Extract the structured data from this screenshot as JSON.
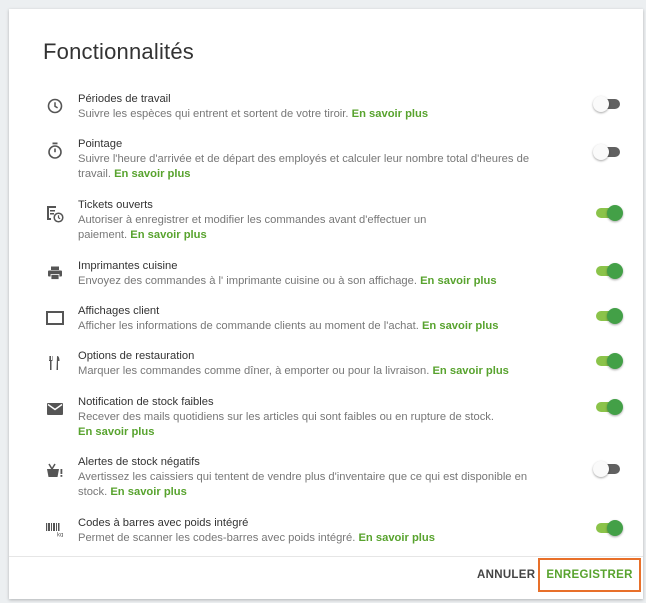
{
  "title": "Fonctionnalités",
  "link_label": "En savoir plus",
  "features": [
    {
      "name": "Périodes de travail",
      "desc": "Suivre les espèces qui entrent et sortent de votre tiroir.",
      "icon": "clock-icon",
      "enabled": false
    },
    {
      "name": "Pointage",
      "desc": "Suivre l'heure d'arrivée et de départ des employés et calculer leur nombre total d'heures de travail.",
      "icon": "stopwatch-icon",
      "enabled": false
    },
    {
      "name": "Tickets ouverts",
      "desc": "Autoriser à enregistrer et modifier les commandes avant d'effectuer un paiement.",
      "icon": "ticket-clock-icon",
      "enabled": true
    },
    {
      "name": "Imprimantes cuisine",
      "desc": "Envoyez des commandes à l' imprimante cuisine ou à son affichage.",
      "icon": "printer-icon",
      "enabled": true
    },
    {
      "name": "Affichages client",
      "desc": "Afficher les informations de commande clients au moment de l'achat.",
      "icon": "display-icon",
      "enabled": true
    },
    {
      "name": "Options de restauration",
      "desc": "Marquer les commandes comme dîner, à emporter ou pour la livraison.",
      "icon": "fork-knife-icon",
      "enabled": true
    },
    {
      "name": "Notification de stock faibles",
      "desc": "Recever des mails quotidiens sur les articles qui sont faibles ou en rupture de stock.",
      "icon": "mail-icon",
      "enabled": true
    },
    {
      "name": "Alertes de stock négatifs",
      "desc": "Avertissez les caissiers qui tentent de vendre plus d'inventaire que ce qui est disponible en stock.",
      "icon": "basket-alert-icon",
      "enabled": false
    },
    {
      "name": "Codes à barres avec poids intégré",
      "desc": "Permet de scanner les codes-barres avec poids intégré.",
      "icon": "barcode-kg-icon",
      "enabled": true
    }
  ],
  "footer": {
    "cancel_label": "ANNULER",
    "save_label": "ENREGISTRER"
  },
  "colors": {
    "accent": "#58a32e",
    "toggle_on_thumb": "#43a047",
    "toggle_on_track": "#8bc34a",
    "highlight_border": "#e8702a"
  }
}
